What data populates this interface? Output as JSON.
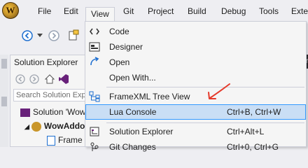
{
  "menubar": {
    "logo_letter": "W",
    "items": [
      "File",
      "Edit",
      "View",
      "Git",
      "Project",
      "Build",
      "Debug",
      "Tools",
      "Exte"
    ]
  },
  "solution_explorer": {
    "title": "Solution Explorer",
    "search_placeholder": "Search Solution Exp",
    "tree": [
      "Solution 'Wow",
      "WowAddo",
      "Frame"
    ]
  },
  "right_tab_label": "rame",
  "view_menu": {
    "items": [
      {
        "icon": "code-icon",
        "label": "Code",
        "shortcut": ""
      },
      {
        "icon": "designer-icon",
        "label": "Designer",
        "shortcut": ""
      },
      {
        "icon": "open-icon",
        "label": "Open",
        "shortcut": ""
      },
      {
        "icon": "",
        "label": "Open With...",
        "shortcut": ""
      },
      {
        "icon": "tree-view-icon",
        "label": "FrameXML Tree View",
        "shortcut": ""
      },
      {
        "icon": "",
        "label": "Lua Console",
        "shortcut": "Ctrl+B, Ctrl+W"
      },
      {
        "icon": "solution-explorer-icon",
        "label": "Solution Explorer",
        "shortcut": "Ctrl+Alt+L"
      },
      {
        "icon": "git-changes-icon",
        "label": "Git Changes",
        "shortcut": "Ctrl+0, Ctrl+G"
      }
    ],
    "highlighted_index": 5
  },
  "colors": {
    "highlight_bg": "#c9def5",
    "highlight_border": "#3399ff",
    "annotation_arrow": "#e53a2b"
  }
}
